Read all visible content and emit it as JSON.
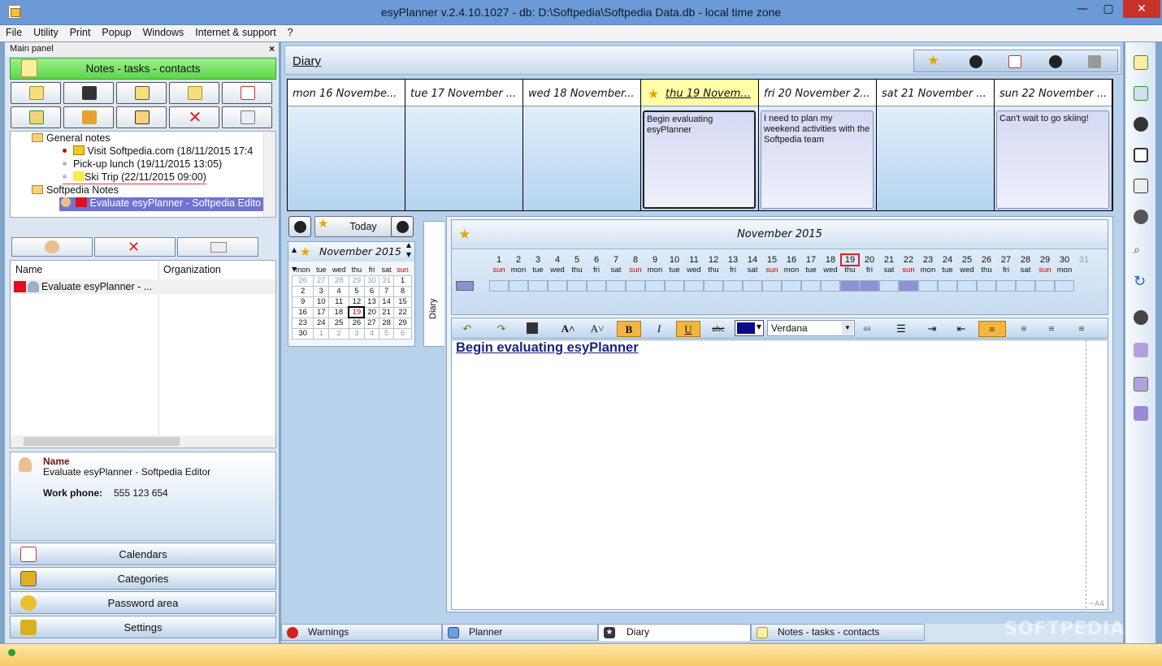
{
  "window": {
    "title": "esyPlanner v.2.4.10.1027 - db: D:\\Softpedia\\Softpedia Data.db - local time zone",
    "minimize": "—",
    "restore": "▢",
    "close": "✕"
  },
  "menu": [
    "File",
    "Utility",
    "Print",
    "Popup",
    "Windows",
    "Internet & support",
    "?"
  ],
  "main_panel": {
    "label": "Main panel",
    "close": "×",
    "section": "Notes - tasks - contacts",
    "tree": [
      {
        "text": "General notes",
        "kind": "folder"
      },
      {
        "text": "Visit Softpedia.com (18/11/2015 17:4",
        "kind": "note"
      },
      {
        "text": "Pick-up lunch (19/11/2015 13:05)",
        "kind": "note"
      },
      {
        "text": "Ski Trip (22/11/2015 09:00)",
        "kind": "note"
      },
      {
        "text": "Softpedia Notes",
        "kind": "folder"
      },
      {
        "text": "Evaluate esyPlanner - Softpedia Edito",
        "kind": "contact"
      }
    ],
    "contacts": {
      "columns": [
        "Name",
        "Organization"
      ],
      "rows": [
        {
          "name": "Evaluate esyPlanner - ...",
          "organization": ""
        }
      ]
    },
    "detail": {
      "name_label": "Name",
      "name_value": "Evaluate esyPlanner - Softpedia Editor",
      "phone_label": "Work phone:",
      "phone_value": "555 123 654"
    },
    "nav": [
      "Calendars",
      "Categories",
      "Password area",
      "Settings"
    ]
  },
  "diary": {
    "title": "Diary",
    "days": [
      {
        "label": "mon 16 Novembe...",
        "note": ""
      },
      {
        "label": "tue 17 November ...",
        "note": ""
      },
      {
        "label": "wed 18 November...",
        "note": ""
      },
      {
        "label": "thu 19 Novem...",
        "note": "Begin evaluating esyPlanner",
        "today": true
      },
      {
        "label": "fri 20 November 2...",
        "note": "I need to plan my weekend activities with the Softpedia team"
      },
      {
        "label": "sat 21 November ...",
        "note": ""
      },
      {
        "label": "sun 22 November ...",
        "note": "Can't wait to go skiing!"
      }
    ],
    "today_button": "Today",
    "vertical_tab": "Diary"
  },
  "mini_calendar": {
    "title": "November 2015",
    "weekdays": [
      "mon",
      "tue",
      "wed",
      "thu",
      "fri",
      "sat",
      "sun"
    ],
    "weeks": [
      [
        "26",
        "27",
        "28",
        "29",
        "30",
        "31",
        "1"
      ],
      [
        "2",
        "3",
        "4",
        "5",
        "6",
        "7",
        "8"
      ],
      [
        "9",
        "10",
        "11",
        "12",
        "13",
        "14",
        "15"
      ],
      [
        "16",
        "17",
        "18",
        "19",
        "20",
        "21",
        "22"
      ],
      [
        "23",
        "24",
        "25",
        "26",
        "27",
        "28",
        "29"
      ],
      [
        "30",
        "1",
        "2",
        "3",
        "4",
        "5",
        "6"
      ]
    ],
    "today": "19"
  },
  "month_strip": {
    "title": "November 2015",
    "days": [
      {
        "n": "1",
        "w": "sun"
      },
      {
        "n": "2",
        "w": "mon"
      },
      {
        "n": "3",
        "w": "tue"
      },
      {
        "n": "4",
        "w": "wed"
      },
      {
        "n": "5",
        "w": "thu"
      },
      {
        "n": "6",
        "w": "fri"
      },
      {
        "n": "7",
        "w": "sat"
      },
      {
        "n": "8",
        "w": "sun"
      },
      {
        "n": "9",
        "w": "mon"
      },
      {
        "n": "10",
        "w": "tue"
      },
      {
        "n": "11",
        "w": "wed"
      },
      {
        "n": "12",
        "w": "thu"
      },
      {
        "n": "13",
        "w": "fri"
      },
      {
        "n": "14",
        "w": "sat"
      },
      {
        "n": "15",
        "w": "sun"
      },
      {
        "n": "16",
        "w": "mon"
      },
      {
        "n": "17",
        "w": "tue"
      },
      {
        "n": "18",
        "w": "wed"
      },
      {
        "n": "19",
        "w": "thu"
      },
      {
        "n": "20",
        "w": "fri"
      },
      {
        "n": "21",
        "w": "sat"
      },
      {
        "n": "22",
        "w": "sun"
      },
      {
        "n": "23",
        "w": "mon"
      },
      {
        "n": "24",
        "w": "tue"
      },
      {
        "n": "25",
        "w": "wed"
      },
      {
        "n": "26",
        "w": "thu"
      },
      {
        "n": "27",
        "w": "fri"
      },
      {
        "n": "28",
        "w": "sat"
      },
      {
        "n": "29",
        "w": "sun"
      },
      {
        "n": "30",
        "w": "mon"
      },
      {
        "n": "31",
        "w": ""
      }
    ],
    "marked": [
      "19",
      "20",
      "22"
    ]
  },
  "editor": {
    "font": "Verdana",
    "small_a": "aa",
    "text_color": "#0a0a8c",
    "content": "Begin evaluating esyPlanner",
    "page_marker": "~A4"
  },
  "bottom_tabs": [
    "Warnings",
    "Planner",
    "Diary",
    "Notes - tasks - contacts"
  ],
  "watermark": "SOFTPEDIA"
}
